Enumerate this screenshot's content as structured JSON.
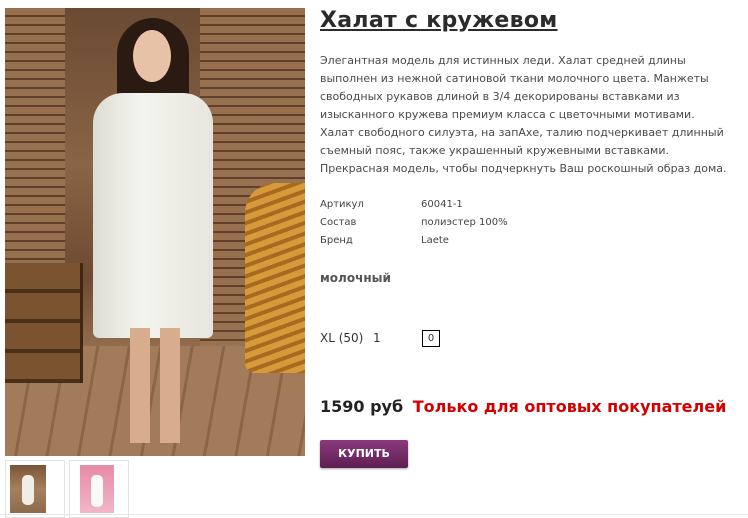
{
  "product": {
    "title": "Халат с кружевом",
    "description": "Элегантная модель для истинных леди. Халат средней длины выполнен из нежной сатиновой ткани молочного цвета. Манжеты свободных рукавов длиной в 3/4 декорированы вставками из изысканного кружева премиум класса с цветочными мотивами. Халат свободного силуэта, на запАхе, талию подчеркивает длинный съемный пояс, также украшенный кружевными вставками. Прекрасная модель, чтобы подчеркнуть Ваш роскошный образ дома.",
    "specs": [
      {
        "key": "Артикул",
        "value": "60041-1"
      },
      {
        "key": "Состав",
        "value": "полиэстер 100%"
      },
      {
        "key": "Бренд",
        "value": "Laete"
      }
    ],
    "color_name": "молочный",
    "size": {
      "label": "XL (50)",
      "stock": "1",
      "order_qty": "0"
    },
    "price": "1590 руб",
    "wholesale_note": "Только для оптовых покупателей",
    "buy_label": "КУПИТЬ"
  },
  "colors": {
    "wholesale_text": "#d40000",
    "buy_button": "#6e2963"
  },
  "images": {
    "main": "product-photo-white-robe",
    "thumbnails": [
      "thumb-white-robe",
      "thumb-pink-robe"
    ]
  }
}
